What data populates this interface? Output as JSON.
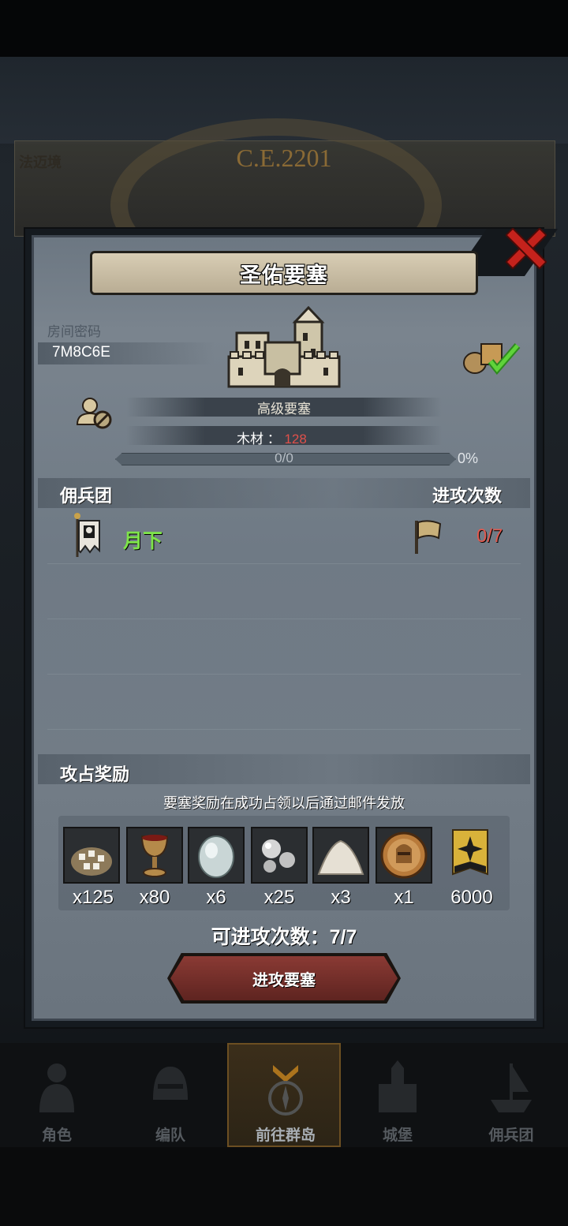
{
  "header": {
    "year": "C.E.2201",
    "location_partial": "法迈境"
  },
  "dialog": {
    "title": "圣佑要塞",
    "room_label": "房间密码",
    "room_code": "7M8C6E",
    "fort_level": "高级要塞",
    "wood_label": "木材",
    "wood_value": "128",
    "progress_text": "0/0",
    "progress_percent": "0%",
    "progress_fraction": 0
  },
  "mercenary": {
    "section_label": "佣兵团",
    "attacks_label": "进攻次数",
    "name": "月下",
    "attack_count": "0/7"
  },
  "rewards": {
    "section_label": "攻占奖励",
    "note": "要塞奖励在成功占领以后通过邮件发放",
    "items": [
      {
        "icon": "sugar-sack-icon",
        "qty": "x125"
      },
      {
        "icon": "goblet-icon",
        "qty": "x80"
      },
      {
        "icon": "moonstone-icon",
        "qty": "x6"
      },
      {
        "icon": "silver-ore-icon",
        "qty": "x25"
      },
      {
        "icon": "salt-pile-icon",
        "qty": "x3"
      },
      {
        "icon": "knight-coin-icon",
        "qty": "x1"
      },
      {
        "icon": "rank-medal-icon",
        "qty": "6000"
      }
    ],
    "attempts": "可进攻次数：7/7",
    "attack_button": "进攻要塞"
  },
  "nav": [
    {
      "label": "角色",
      "icon": "knight-icon"
    },
    {
      "label": "编队",
      "icon": "helmet-icon"
    },
    {
      "label": "前往群岛",
      "icon": "compass-icon",
      "active": true
    },
    {
      "label": "城堡",
      "icon": "castle-icon"
    },
    {
      "label": "佣兵团",
      "icon": "ship-icon"
    }
  ],
  "colors": {
    "accent_green": "#7ee34a",
    "accent_red": "#e05a50",
    "button": "#8a3a34",
    "close": "#c4221c"
  }
}
